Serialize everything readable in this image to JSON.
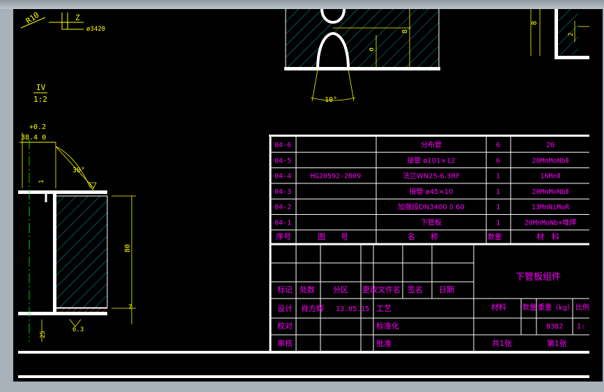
{
  "colors": {
    "background": "#000000",
    "outline": "#ffffff",
    "table_text": "#ff00ff",
    "dimension": "#ffff00",
    "hatch": "#00d0d0",
    "centerline": "#00ff00",
    "weld": "#ff3030",
    "frame": "#a9b1b9"
  },
  "annotations": {
    "roughness_label": "R10",
    "z_label": "Z",
    "diameter_label": "ø3420",
    "section_view_label": "IV",
    "section_view_scale": "1:2",
    "tolerance_upper": "+0.2",
    "tolerance_base": "38.4 0",
    "angle_label": "30°",
    "dim_80": "80",
    "dim_1": "1",
    "dim_7": "7",
    "dim_25": "25",
    "dim_63": "6.3",
    "groove_angle": "10°",
    "groove_dim_a": "8",
    "groove_dim_b": "σ",
    "right_dim_a": "8",
    "right_dim_b": "2"
  },
  "bom": {
    "rows": [
      {
        "code": "04-6",
        "drawing": "",
        "name": "分布管",
        "qty": "6",
        "material": "20"
      },
      {
        "code": "04-5",
        "drawing": "",
        "name": "接管 ø101×12",
        "qty": "6",
        "material": "20MnMoNbⅡ"
      },
      {
        "code": "04-4",
        "drawing": "HG20592-2009",
        "name": "法兰WN25-6.3RF",
        "qty": "1",
        "material": "16MnⅡ"
      },
      {
        "code": "04-3",
        "drawing": "",
        "name": "接管 ø45×10",
        "qty": "1",
        "material": "20MnMoNbⅡ"
      },
      {
        "code": "04-2",
        "drawing": "",
        "name": "加强段DN3400 δ 60",
        "qty": "1",
        "material": "13MnNiMoR"
      },
      {
        "code": "04-1",
        "drawing": "",
        "name": "下管板",
        "qty": "1",
        "material": "20MnMoNb+堆焊"
      }
    ],
    "header": {
      "code": "序号",
      "drawing": "图　　号",
      "name": "名　　称",
      "qty": "数量",
      "material": "材　料"
    }
  },
  "title_block": {
    "row_labels": [
      "标记",
      "处数",
      "分区",
      "更改文件名",
      "签名",
      "日期"
    ],
    "design": "设计",
    "designer": "肖方辉",
    "date": "13.05.15",
    "process": "工艺",
    "check": "校对",
    "standardize": "标准化",
    "review": "审核",
    "approve": "批准",
    "assembly_name": "下管板组件",
    "material": "材料",
    "quantity": "数量",
    "weight": "重量（kg）",
    "ratio": "比例",
    "weight_value": "8382",
    "ratio_value": "1:",
    "sheets_total": "共1张",
    "sheet_no": "第1张"
  }
}
